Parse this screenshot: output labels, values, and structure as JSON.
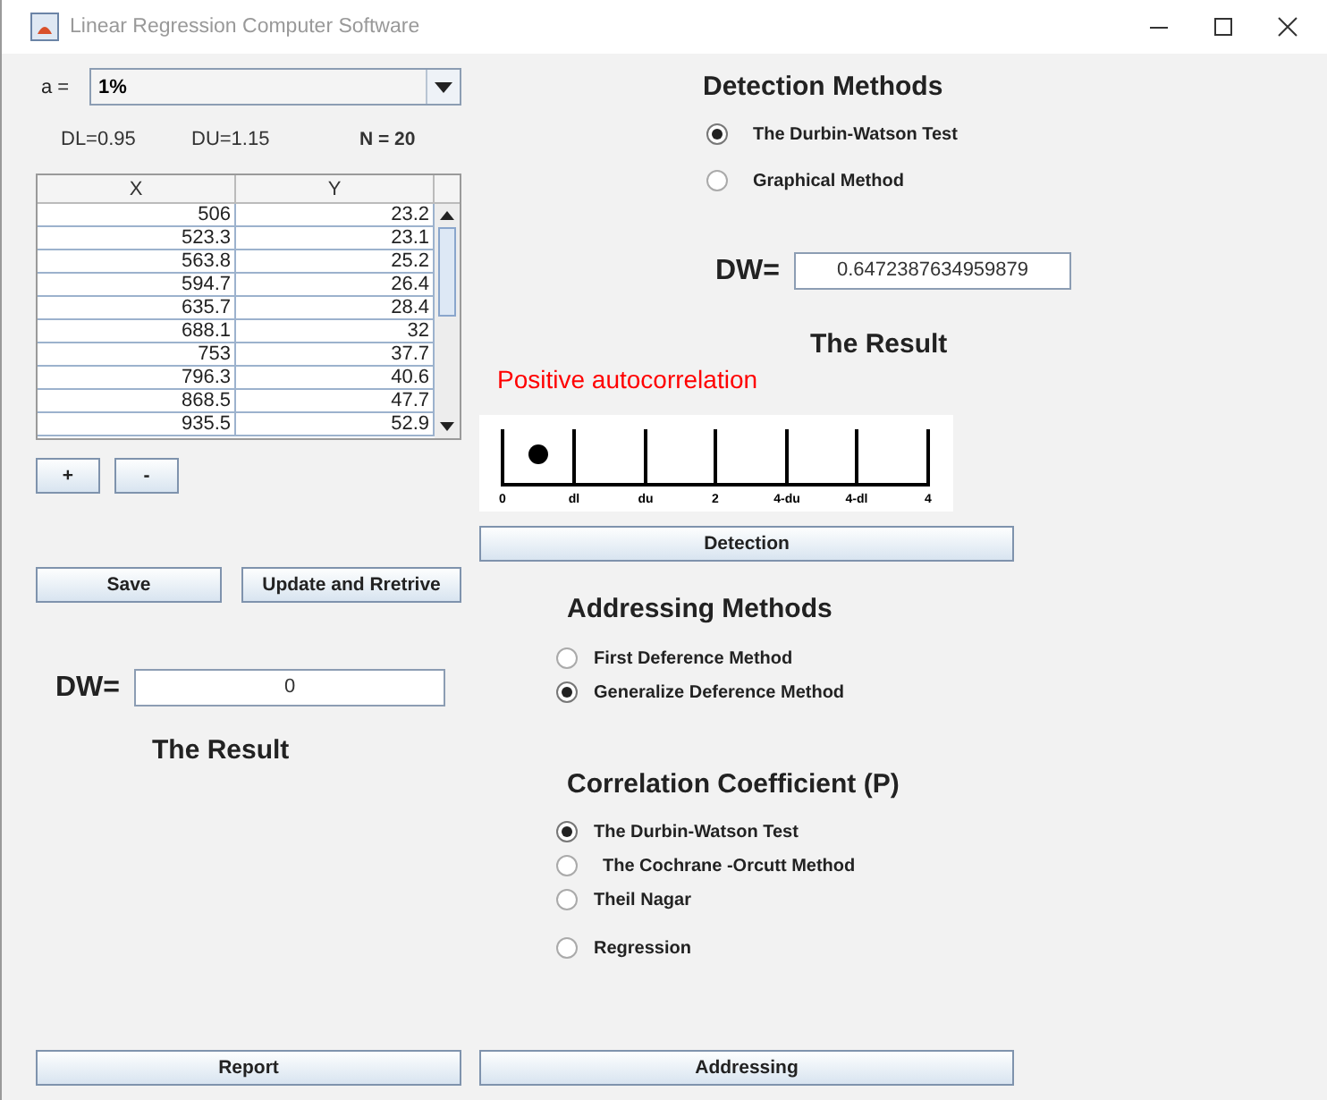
{
  "window": {
    "title": "Linear Regression Computer Software"
  },
  "alpha": {
    "label": "a =",
    "value": "1%"
  },
  "stats": [
    "DL=0.95",
    "DU=1.15",
    "N = 20"
  ],
  "table": {
    "columns": [
      "X",
      "Y"
    ],
    "rows": [
      [
        "506",
        "23.2"
      ],
      [
        "523.3",
        "23.1"
      ],
      [
        "563.8",
        "25.2"
      ],
      [
        "594.7",
        "26.4"
      ],
      [
        "635.7",
        "28.4"
      ],
      [
        "688.1",
        "32"
      ],
      [
        "753",
        "37.7"
      ],
      [
        "796.3",
        "40.6"
      ],
      [
        "868.5",
        "47.7"
      ],
      [
        "935.5",
        "52.9"
      ]
    ]
  },
  "row_buttons": [
    "+",
    "-"
  ],
  "left_buttons": [
    "Save",
    "Update and Rretrive"
  ],
  "left_dw": {
    "label": "DW=",
    "value": "0"
  },
  "left_result": "The Result",
  "report_button": "Report",
  "detection": {
    "title": "Detection Methods",
    "options": [
      {
        "label": "The Durbin-Watson Test",
        "selected": true
      },
      {
        "label": "Graphical Method",
        "selected": false
      }
    ],
    "dw": {
      "label": "DW=",
      "value": "0.6472387634959879"
    },
    "result_title": "The Result",
    "result": "Positive autocorrelation",
    "scale": {
      "labels": [
        "0",
        "dl",
        "du",
        "2",
        "4-du",
        "4-dl",
        "4"
      ],
      "marker": {
        "level": 0.084
      }
    },
    "button": "Detection"
  },
  "addressing": {
    "title": "Addressing Methods",
    "options": [
      {
        "label": "First Deference Method",
        "selected": false
      },
      {
        "label": "Generalize Deference Method",
        "selected": true
      }
    ]
  },
  "correlation": {
    "title": "Correlation Coefficient (P)",
    "options": [
      {
        "label": "The Durbin-Watson Test",
        "selected": true
      },
      {
        "label": "The Cochrane -Orcutt Method",
        "selected": false
      },
      {
        "label": "Theil Nagar",
        "selected": false
      },
      {
        "label": "Regression",
        "selected": false
      }
    ],
    "button": "Addressing"
  }
}
